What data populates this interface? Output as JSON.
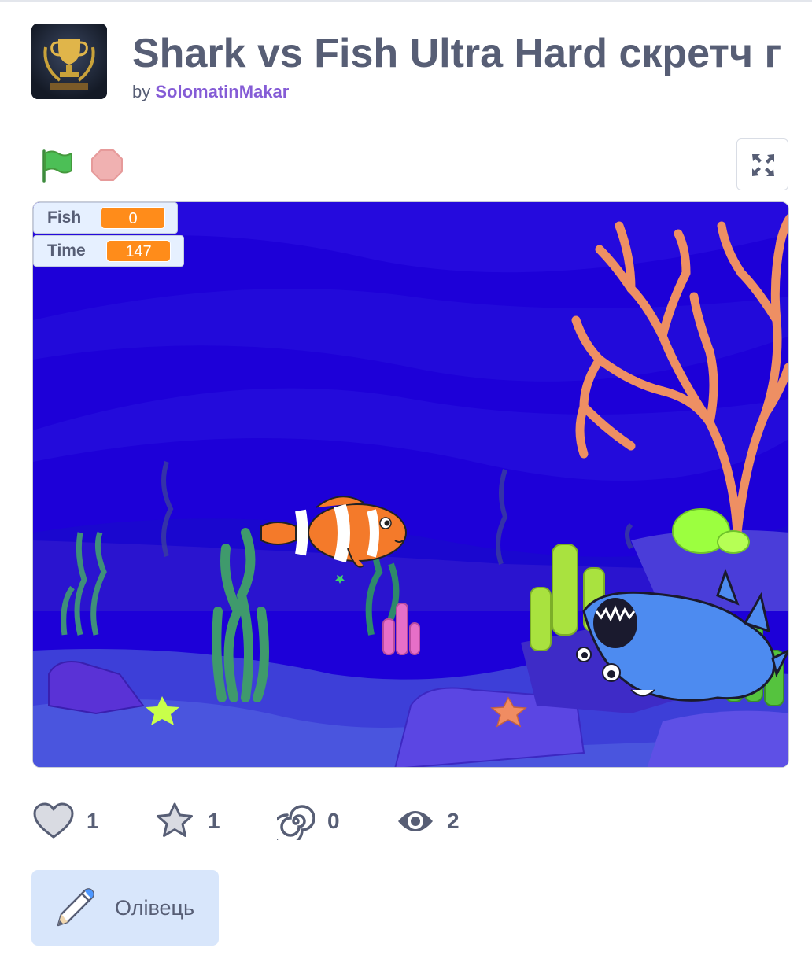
{
  "project": {
    "title": "Shark vs Fish Ultra Hard скретч г",
    "by_label": "by",
    "author": "SolomatinMakar"
  },
  "controls": {
    "green_flag_icon": "green-flag-icon",
    "stop_icon": "stop-icon",
    "fullscreen_icon": "fullscreen-icon"
  },
  "monitors": [
    {
      "label": "Fish",
      "value": "0"
    },
    {
      "label": "Time",
      "value": "147"
    }
  ],
  "stats": {
    "loves": "1",
    "favorites": "1",
    "remixes": "0",
    "views": "2"
  },
  "extension_button": {
    "label": "Олівець",
    "icon": "pen-icon"
  },
  "colors": {
    "title_text": "#575e75",
    "author_link": "#855cd6",
    "green_flag": "#4cbf56",
    "stop": "#f0b1b1",
    "monitor_value": "#ff8c1a",
    "stage_water": "#1d00d8",
    "extension_bg": "#d8e6fb"
  }
}
